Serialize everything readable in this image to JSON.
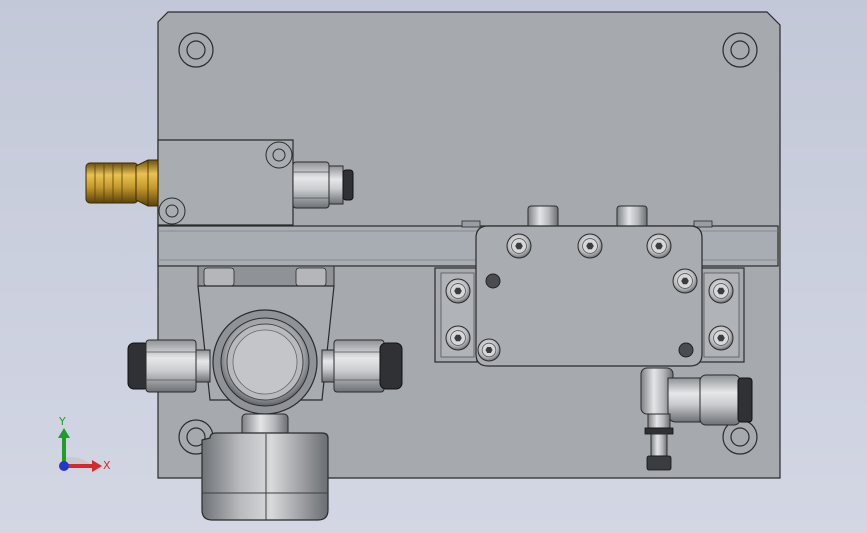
{
  "viewport": {
    "background_top": "#c3c8d8",
    "background_bottom": "#d3d7e4"
  },
  "triad": {
    "y_label": "Y",
    "x_label": "X",
    "y_color": "#1f9d2a",
    "x_color": "#d42a2a",
    "z_color": "#2437c8"
  },
  "colors": {
    "plate": "#a6a9ae",
    "plate_edge": "#2b2b2b",
    "rail": "#a8acb3",
    "brass": "#b8912a",
    "steel": "#bfc1c4"
  }
}
